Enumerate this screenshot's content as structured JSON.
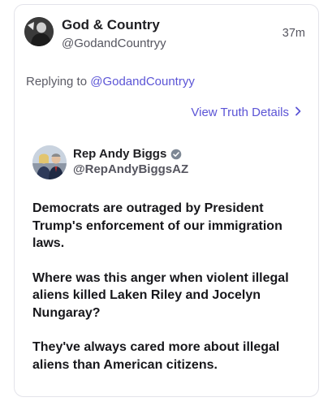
{
  "post": {
    "author_name": "God & Country",
    "author_handle": "@GodandCountryy",
    "timestamp": "37m",
    "replying_prefix": "Replying to ",
    "replying_handle": "@GodandCountryy",
    "view_details_label": "View Truth Details"
  },
  "quote": {
    "author_name": "Rep Andy Biggs",
    "author_handle": "@RepAndyBiggsAZ",
    "paragraphs": [
      "Democrats are outraged by President Trump's enforcement of our immigration laws.",
      "Where was this anger when violent illegal aliens killed Laken Riley and Jocelyn Nungaray?",
      "They've always cared more about illegal aliens than American citizens."
    ]
  },
  "colors": {
    "accent": "#5b54d6",
    "text": "#1f1f23",
    "muted": "#55555f",
    "border": "#e3e3ea"
  },
  "icons": {
    "verified": "verified-badge-icon",
    "chevron": "chevron-right-icon"
  }
}
